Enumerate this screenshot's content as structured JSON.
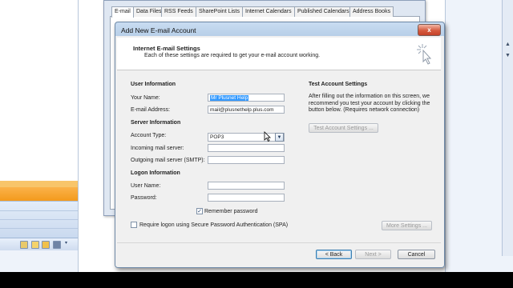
{
  "background": {
    "tabs": [
      "E-mail",
      "Data Files",
      "RSS Feeds",
      "SharePoint Lists",
      "Internet Calendars",
      "Published Calendars",
      "Address Books"
    ],
    "toolbar_icons": [
      "calendar-icon",
      "folder-icon",
      "shortcut-icon",
      "journal-icon",
      "overflow-icon"
    ]
  },
  "dialog": {
    "title": "Add New E-mail Account",
    "close_label": "x",
    "header_title": "Internet E-mail Settings",
    "header_subtitle": "Each of these settings are required to get your e-mail account working.",
    "user_info": {
      "heading": "User Information",
      "name_label": "Your Name:",
      "name_value": "Mr Plusnet Help",
      "email_label": "E-mail Address:",
      "email_value": "mail@plusnethelp.plus.com"
    },
    "server_info": {
      "heading": "Server Information",
      "type_label": "Account Type:",
      "type_value": "POP3",
      "incoming_label": "Incoming mail server:",
      "incoming_value": "",
      "outgoing_label": "Outgoing mail server (SMTP):",
      "outgoing_value": ""
    },
    "logon_info": {
      "heading": "Logon Information",
      "username_label": "User Name:",
      "username_value": "",
      "password_label": "Password:",
      "password_value": "",
      "remember_label": "Remember password",
      "remember_checked": true
    },
    "spa_label": "Require logon using Secure Password Authentication (SPA)",
    "test": {
      "heading": "Test Account Settings",
      "text": "After filling out the information on this screen, we recommend you test your account by clicking the button below. (Requires network connection)",
      "button": "Test Account Settings ..."
    },
    "more_settings": "More Settings ...",
    "back": "< Back",
    "next": "Next >",
    "cancel": "Cancel"
  },
  "colors": {
    "selection": "#3399ff",
    "close_button": "#d65b3f",
    "outlook_orange": "#f39a1c"
  }
}
